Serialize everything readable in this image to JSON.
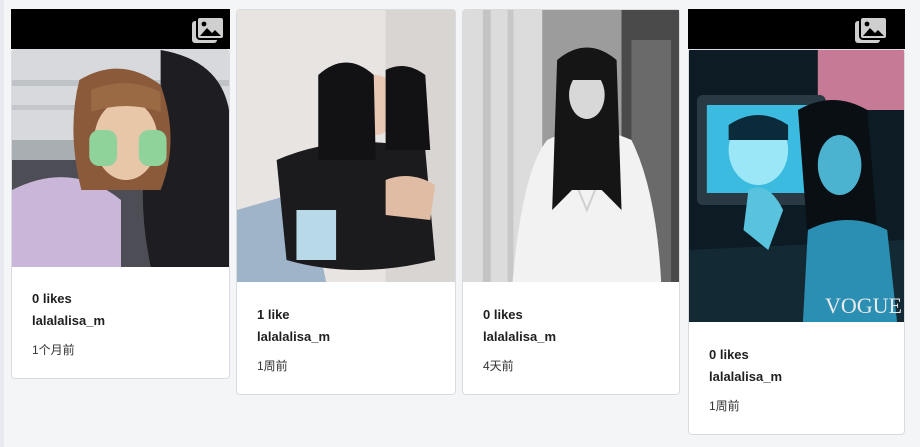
{
  "posts": [
    {
      "likes": "0 likes",
      "username": "lalalalisa_m",
      "time": "1个月前",
      "is_gallery": true
    },
    {
      "likes": "1 like",
      "username": "lalalalisa_m",
      "time": "1周前",
      "is_gallery": false
    },
    {
      "likes": "0 likes",
      "username": "lalalalisa_m",
      "time": "4天前",
      "is_gallery": false
    },
    {
      "likes": "0 likes",
      "username": "lalalalisa_m",
      "time": "1周前",
      "is_gallery": true
    }
  ],
  "overlay_text": {
    "vogue": "VOGUE"
  }
}
